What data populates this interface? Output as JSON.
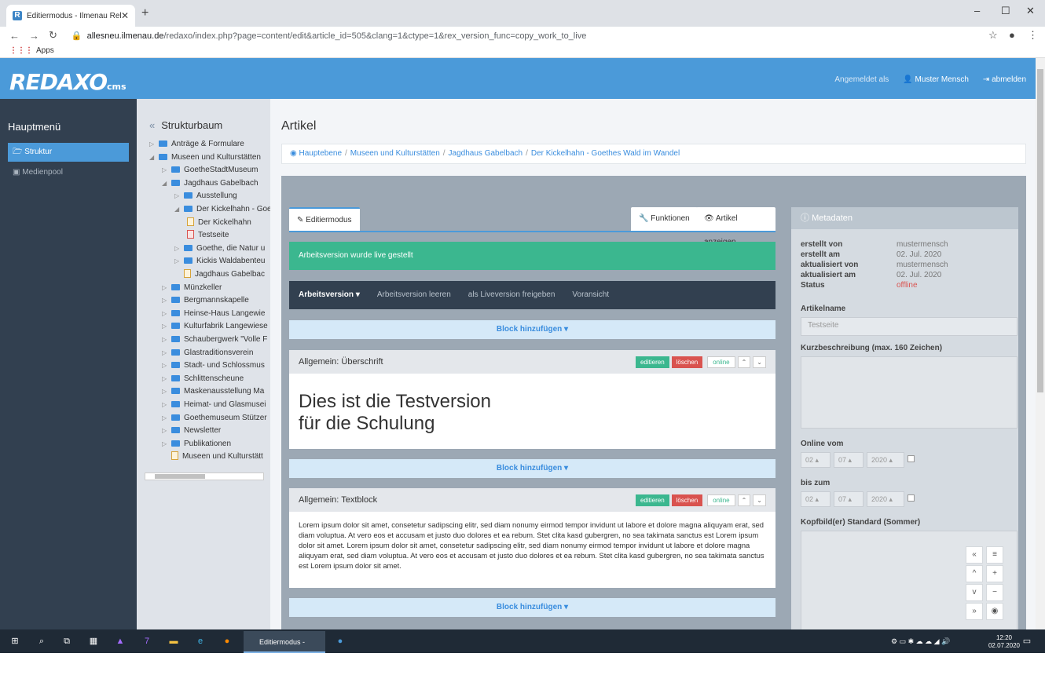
{
  "browser": {
    "tab_title": "Editiermodus - Ilmenau Relaunch",
    "url_host": "allesneu.ilmenau.de",
    "url_path": "/redaxo/index.php?page=content/edit&article_id=505&clang=1&ctype=1&rex_version_func=copy_work_to_live",
    "bookmarks_apps": "Apps"
  },
  "header": {
    "logo": "REDAXO",
    "logo_sub": "cms",
    "logged_in_as": "Angemeldet als",
    "user": "Muster Mensch",
    "logout": "abmelden"
  },
  "sidebar": {
    "title": "Hauptmenü",
    "items": [
      {
        "label": "Struktur"
      },
      {
        "label": "Medienpool"
      }
    ]
  },
  "tree": {
    "title": "Strukturbaum",
    "nodes": [
      {
        "label": "Anträge & Formulare"
      },
      {
        "label": "Museen und Kulturstätten"
      },
      {
        "label": "GoetheStadtMuseum"
      },
      {
        "label": "Jagdhaus Gabelbach"
      },
      {
        "label": "Ausstellung"
      },
      {
        "label": "Der Kickelhahn - Goethes Wald im Wandel"
      },
      {
        "label": "Der Kickelhahn"
      },
      {
        "label": "Testseite"
      },
      {
        "label": "Goethe, die Natur u"
      },
      {
        "label": "Kickis Waldabenteu"
      },
      {
        "label": "Jagdhaus Gabelbac"
      },
      {
        "label": "Münzkeller"
      },
      {
        "label": "Bergmannskapelle"
      },
      {
        "label": "Heinse-Haus Langewie"
      },
      {
        "label": "Kulturfabrik Langewiese"
      },
      {
        "label": "Schaubergwerk \"Volle F"
      },
      {
        "label": "Glastraditionsverein"
      },
      {
        "label": "Stadt- und Schlossmus"
      },
      {
        "label": "Schlittenscheune"
      },
      {
        "label": "Maskenausstellung Ma"
      },
      {
        "label": "Heimat- und Glasmusei"
      },
      {
        "label": "Goethemuseum Stützer"
      },
      {
        "label": "Newsletter"
      },
      {
        "label": "Publikationen"
      },
      {
        "label": "Museen und Kulturstätt"
      }
    ]
  },
  "main": {
    "title": "Artikel",
    "breadcrumb": [
      "Hauptebene",
      "Museen und Kulturstätten",
      "Jagdhaus Gabelbach",
      "Der Kickelhahn - Goethes Wald im Wandel"
    ],
    "tabs": {
      "edit": "Editiermodus",
      "functions": "Funktionen",
      "view": "Artikel anzeigen"
    },
    "alert": "Arbeitsversion wurde live gestellt",
    "version_toolbar": {
      "current": "Arbeitsversion",
      "clear": "Arbeitsversion leeren",
      "release": "als Liveversion freigeben",
      "preview": "Voransicht"
    },
    "add_block": "Block hinzufügen",
    "slices": [
      {
        "title": "Allgemein: Überschrift",
        "content_line1": "Dies ist die Testversion",
        "content_line2": "für die Schulung"
      },
      {
        "title": "Allgemein: Textblock",
        "content": "Lorem ipsum dolor sit amet, consetetur sadipscing elitr, sed diam nonumy eirmod tempor invidunt ut labore et dolore magna aliquyam erat, sed diam voluptua. At vero eos et accusam et justo duo dolores et ea rebum. Stet clita kasd gubergren, no sea takimata sanctus est Lorem ipsum dolor sit amet. Lorem ipsum dolor sit amet, consetetur sadipscing elitr, sed diam nonumy eirmod tempor invidunt ut labore et dolore magna aliquyam erat, sed diam voluptua. At vero eos et accusam et justo duo dolores et ea rebum. Stet clita kasd gubergren, no sea takimata sanctus est Lorem ipsum dolor sit amet."
      }
    ],
    "slice_buttons": {
      "edit": "editieren",
      "delete": "löschen",
      "status": "online"
    }
  },
  "meta": {
    "title": "Metadaten",
    "rows": [
      {
        "label": "erstellt von",
        "value": "mustermensch"
      },
      {
        "label": "erstellt am",
        "value": "02. Jul. 2020"
      },
      {
        "label": "aktualisiert von",
        "value": "mustermensch"
      },
      {
        "label": "aktualisiert am",
        "value": "02. Jul. 2020"
      },
      {
        "label": "Status",
        "value": "offline"
      }
    ],
    "article_name_label": "Artikelname",
    "article_name_value": "Testseite",
    "short_desc_label": "Kurzbeschreibung (max. 160 Zeichen)",
    "online_from_label": "Online vom",
    "online_to_label": "bis zum",
    "date_day": "02",
    "date_month": "07",
    "date_year": "2020",
    "header_image_label": "Kopfbild(er) Standard (Sommer)"
  },
  "taskbar": {
    "active_app": "Editiermodus - Ilme...",
    "time": "12:20",
    "date": "02.07.2020"
  },
  "colors": {
    "accent": "#4b9ad9",
    "sidebar": "#324050",
    "success": "#3bb78f",
    "danger": "#d9534f"
  }
}
